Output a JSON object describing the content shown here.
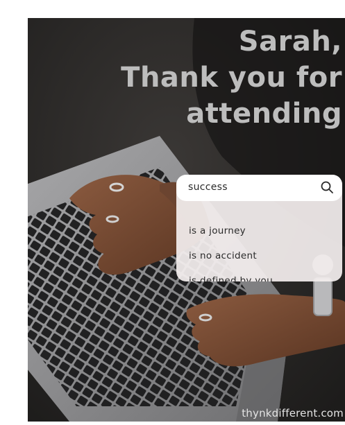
{
  "headline": {
    "line1": "Sarah,",
    "line2": "Thank you for",
    "line3": "attending"
  },
  "search": {
    "query": "success",
    "suggestions": [
      "is a journey",
      "is no accident",
      "is defined by you"
    ]
  },
  "footer": {
    "website": "thynkdifferent.com"
  },
  "colors": {
    "background": "#2b2927",
    "headline": "#bdbdbd",
    "card": "#f3eeee"
  },
  "icons": {
    "search": "search-icon"
  }
}
